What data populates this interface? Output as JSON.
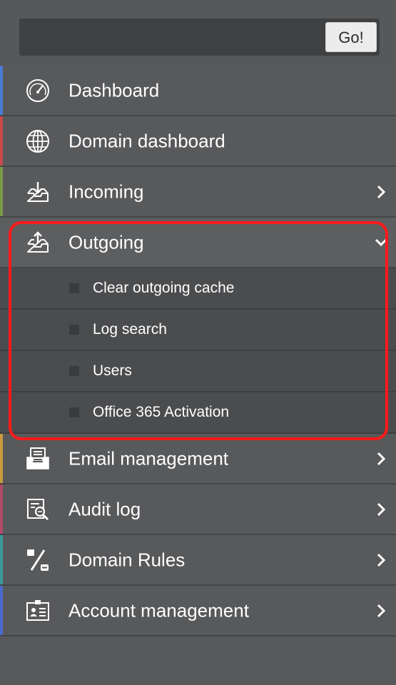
{
  "search": {
    "value": "",
    "placeholder": "",
    "button_label": "Go!"
  },
  "menu": {
    "items": [
      {
        "label": "Dashboard",
        "icon": "dashboard-gauge-icon",
        "accent": "#4a7bd0",
        "has_chevron": false
      },
      {
        "label": "Domain dashboard",
        "icon": "globe-icon",
        "accent": "#c94a4a",
        "has_chevron": false
      },
      {
        "label": "Incoming",
        "icon": "inbox-download-icon",
        "accent": "#7a9a4a",
        "has_chevron": true,
        "chevron": "chevron-right-icon"
      },
      {
        "label": "Outgoing",
        "icon": "outbox-upload-icon",
        "accent": "",
        "has_chevron": true,
        "chevron": "chevron-down-icon",
        "expanded": true
      },
      {
        "label": "Email management",
        "icon": "email-tray-icon",
        "accent": "#c99a3a",
        "has_chevron": true,
        "chevron": "chevron-right-icon"
      },
      {
        "label": "Audit log",
        "icon": "audit-search-icon",
        "accent": "#b04a6a",
        "has_chevron": true,
        "chevron": "chevron-right-icon"
      },
      {
        "label": "Domain Rules",
        "icon": "percent-rules-icon",
        "accent": "#3a9a9a",
        "has_chevron": true,
        "chevron": "chevron-right-icon"
      },
      {
        "label": "Account management",
        "icon": "id-card-icon",
        "accent": "#4a6ad0",
        "has_chevron": true,
        "chevron": "chevron-right-icon"
      }
    ],
    "outgoing_subitems": [
      {
        "label": "Clear outgoing cache"
      },
      {
        "label": "Log search"
      },
      {
        "label": "Users"
      },
      {
        "label": "Office 365 Activation"
      }
    ]
  },
  "colors": {
    "sidebar_bg": "#58595b",
    "submenu_bg": "#4b4c4e",
    "highlight": "#ff1a1a",
    "text": "#ffffff"
  }
}
